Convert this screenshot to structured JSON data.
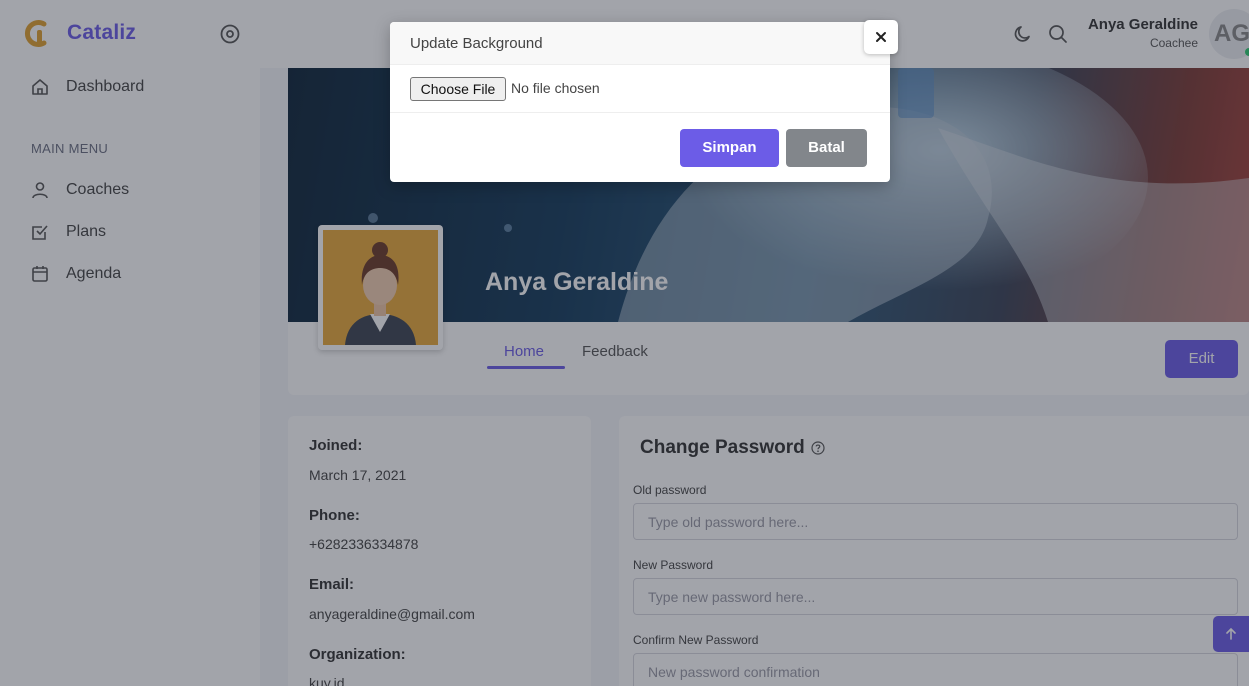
{
  "brand": {
    "name": "Cataliz",
    "logo_icon": "cataliz-logo-icon"
  },
  "sidebar": {
    "dashboard": {
      "label": "Dashboard",
      "icon": "home-icon"
    },
    "section_heading": "MAIN MENU",
    "items": [
      {
        "label": "Coaches",
        "icon": "user-icon"
      },
      {
        "label": "Plans",
        "icon": "checkbox-icon"
      },
      {
        "label": "Agenda",
        "icon": "calendar-icon"
      }
    ]
  },
  "header": {
    "user_name": "Anya Geraldine",
    "user_role": "Coachee",
    "avatar_initials": "AG",
    "icons": [
      "moon-icon",
      "search-icon"
    ]
  },
  "profile": {
    "name": "Anya Geraldine",
    "tabs": [
      "Home",
      "Feedback"
    ],
    "active_tab": "Home",
    "edit_label": "Edit"
  },
  "info": {
    "joined_label": "Joined:",
    "joined_value": "March 17, 2021",
    "phone_label": "Phone:",
    "phone_value": "+6282336334878",
    "email_label": "Email:",
    "email_value": "anyageraldine@gmail.com",
    "org_label": "Organization:",
    "org_value": "kuy.id"
  },
  "password": {
    "title": "Change Password",
    "old_label": "Old password",
    "old_placeholder": "Type old password here...",
    "new_label": "New Password",
    "new_placeholder": "Type new password here...",
    "confirm_label": "Confirm New Password",
    "confirm_placeholder": "New password confirmation"
  },
  "modal": {
    "title": "Update Background",
    "file_button": "Choose File",
    "file_status": "No file chosen",
    "save_label": "Simpan",
    "cancel_label": "Batal"
  },
  "colors": {
    "accent": "#6c5ce7",
    "secondary": "#82868b",
    "online": "#2ecc71"
  }
}
